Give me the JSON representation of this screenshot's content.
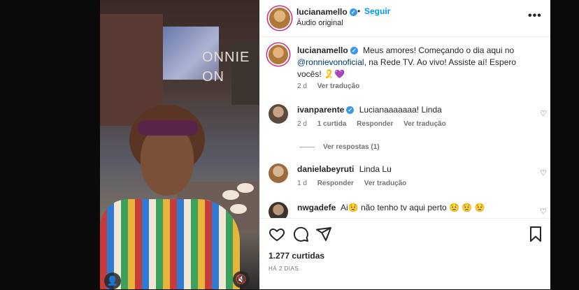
{
  "post": {
    "author": "lucianamello",
    "follow_label": "Seguir",
    "separator": "•",
    "audio": "Áudio original",
    "more_icon": "more-horizontal-icon"
  },
  "media": {
    "wall_text": "ONNIE\nON"
  },
  "caption": {
    "user": "lucianamello",
    "text_before": "Meus amores! Começando o dia aqui no ",
    "mention": "@ronnievonoficial",
    "text_after": ", na Rede TV. Ao vivo! Assiste aí! Espero vocês! 🎗️💜",
    "time": "2 d",
    "translate": "Ver tradução"
  },
  "comments": [
    {
      "user": "ivanparente",
      "verified": true,
      "text": "Lucianaaaaaaa! Linda",
      "time": "2 d",
      "likes": "1 curtida",
      "reply": "Responder",
      "translate": "Ver tradução"
    },
    {
      "user": "danielabeyruti",
      "verified": false,
      "text": "Linda Lu",
      "time": "1 d",
      "reply": "Responder",
      "translate": "Ver tradução"
    },
    {
      "user": "nwgadefe",
      "verified": false,
      "text": "Ai😟  não tenho tv aqui perto  😟 😟 😟"
    }
  ],
  "view_replies": "Ver respostas (1)",
  "footer": {
    "likes": "1.277 curtidas",
    "ago": "HÁ 2 DIAS"
  },
  "colors": {
    "accent": "#0095f6",
    "verified": "#3897f0",
    "muted": "#737373"
  }
}
